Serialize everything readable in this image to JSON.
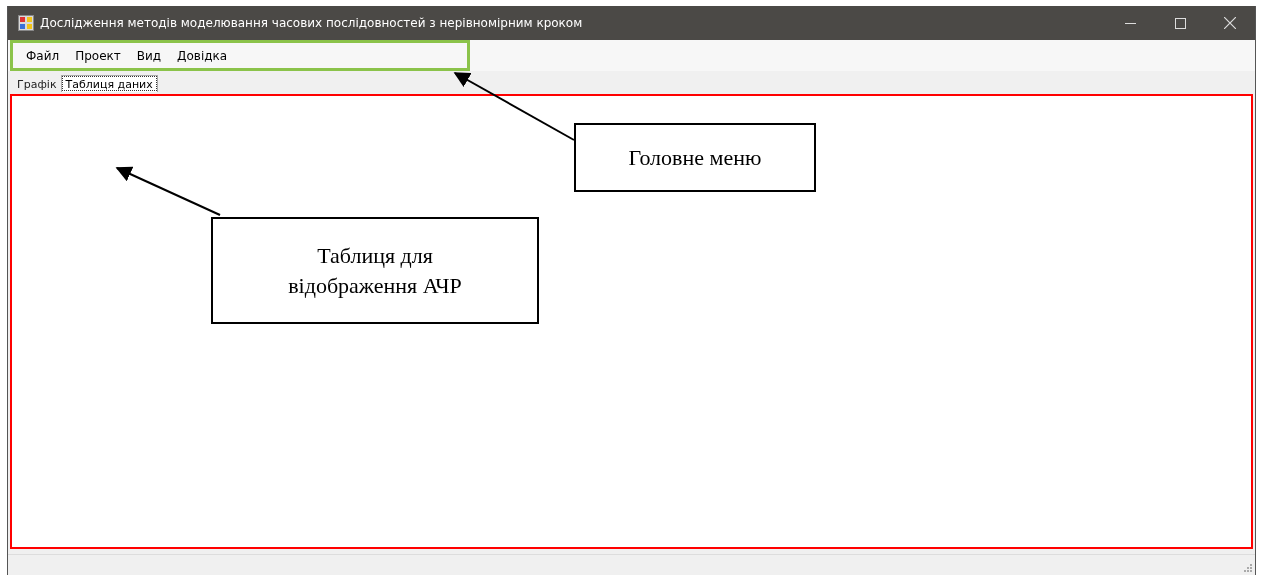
{
  "window": {
    "title": "Дослідження методів моделювання часових послідовностей з нерівномірним кроком"
  },
  "menu": [
    "Файл",
    "Проект",
    "Вид",
    "Довідка"
  ],
  "tabs": [
    {
      "label": "Графік",
      "selected": false
    },
    {
      "label": "Таблиця даних",
      "selected": true
    }
  ],
  "annotations": [
    {
      "text": "Головне меню",
      "kind": "menu"
    },
    {
      "text": "Таблиця для відображення АЧР",
      "kind": "table"
    }
  ]
}
